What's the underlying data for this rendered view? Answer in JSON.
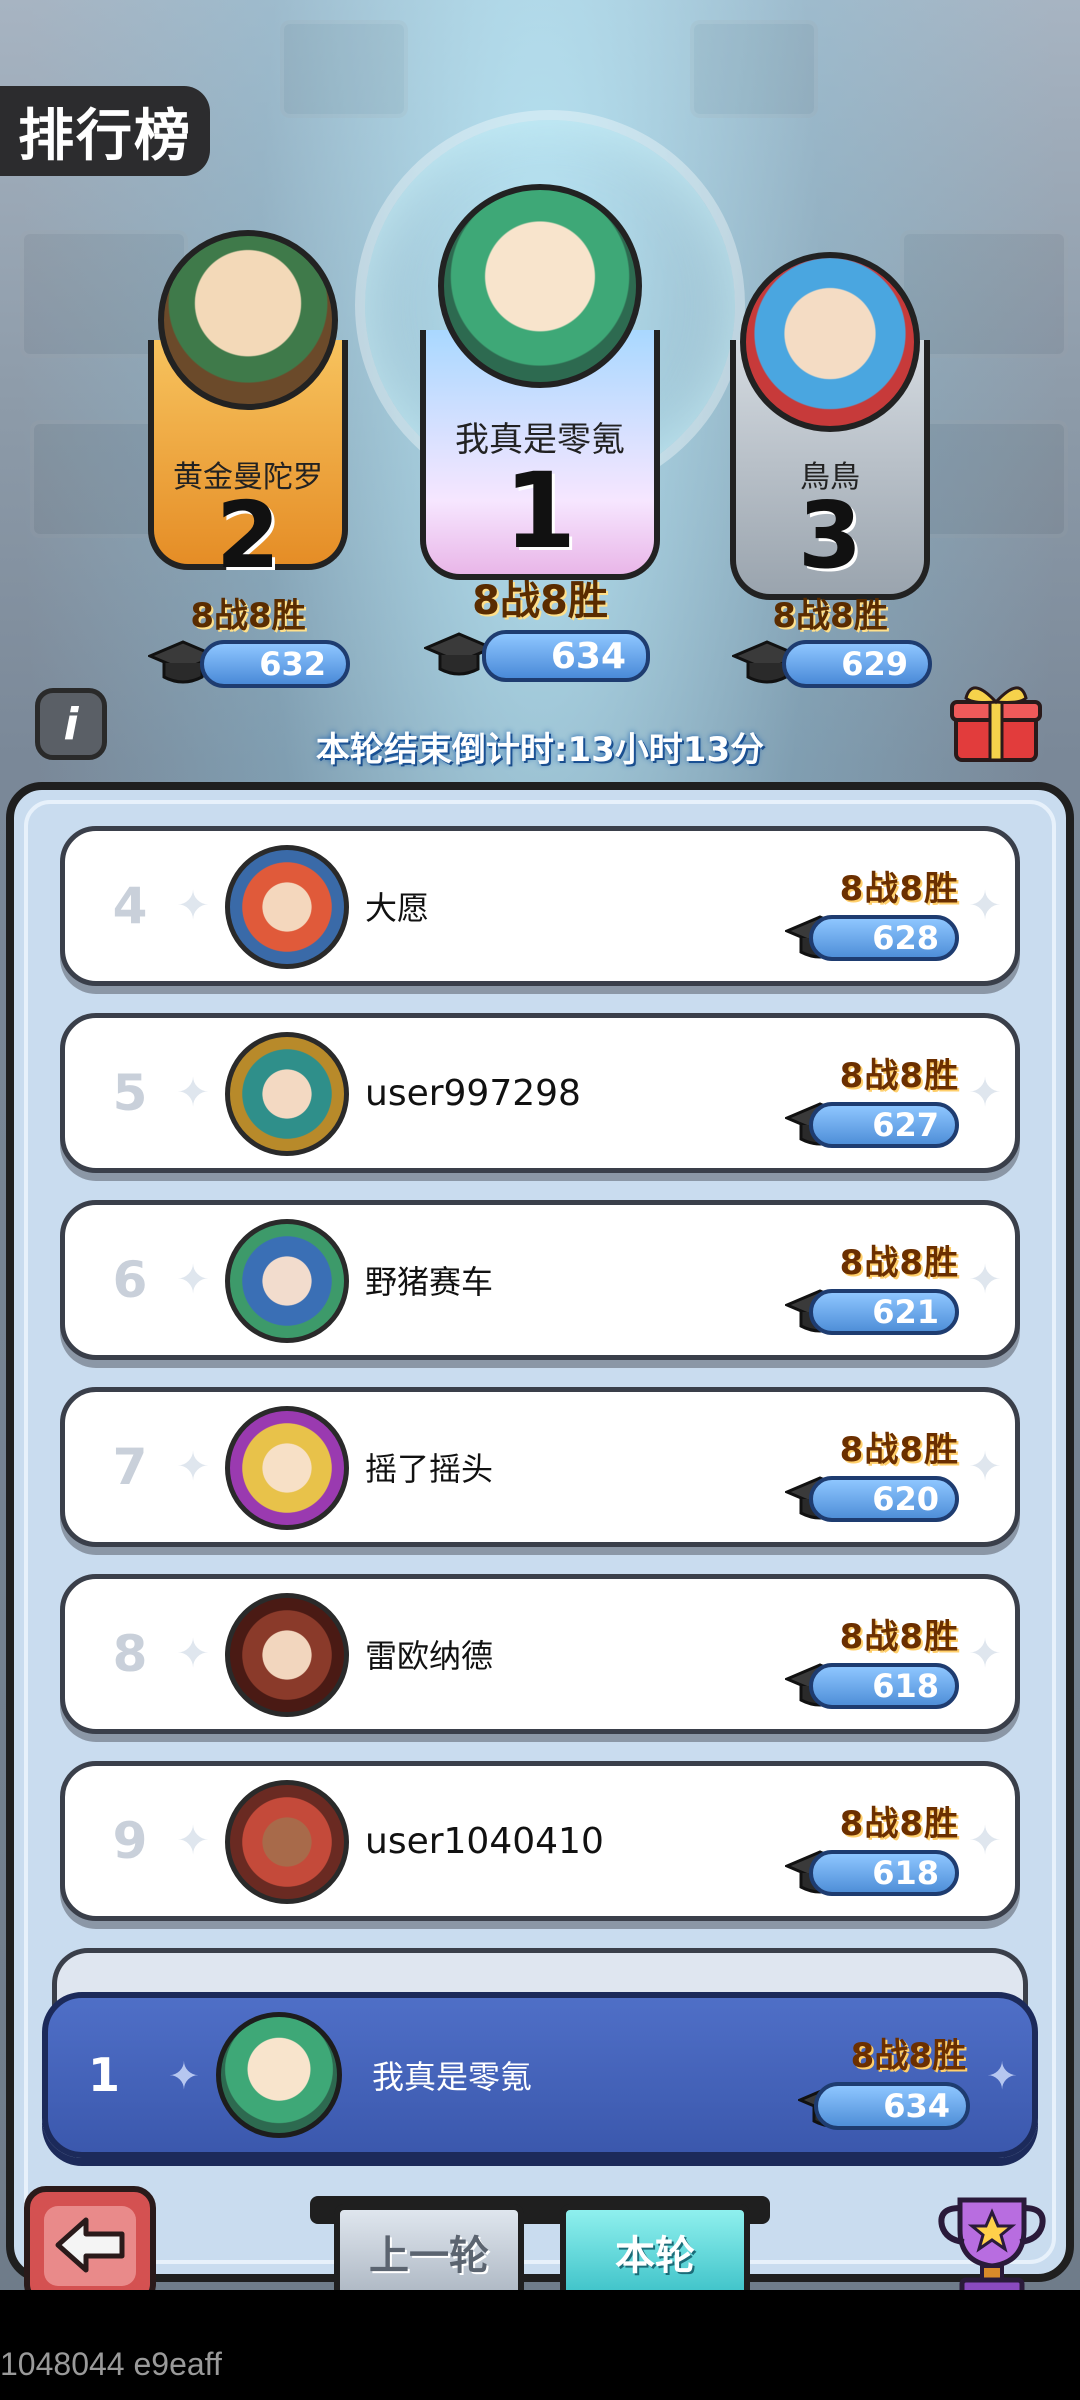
{
  "header": {
    "title": "排行榜"
  },
  "podium": [
    {
      "rank": "2",
      "name": "黄金曼陀罗",
      "record": "8战8胜",
      "score": "632",
      "banner_color": "#f0a23a"
    },
    {
      "rank": "1",
      "name": "我真是零氪",
      "record": "8战8胜",
      "score": "634",
      "banner_color": "#e8d8ff"
    },
    {
      "rank": "3",
      "name": "鳥鳥",
      "record": "8战8胜",
      "score": "629",
      "banner_color": "#b9c2ca"
    }
  ],
  "countdown": "本轮结束倒计时:13小时13分",
  "rows": [
    {
      "rank": "4",
      "name": "大愿",
      "record": "8战8胜",
      "score": "628"
    },
    {
      "rank": "5",
      "name": "user997298",
      "record": "8战8胜",
      "score": "627"
    },
    {
      "rank": "6",
      "name": "野猪赛车",
      "record": "8战8胜",
      "score": "621"
    },
    {
      "rank": "7",
      "name": "摇了摇头",
      "record": "8战8胜",
      "score": "620"
    },
    {
      "rank": "8",
      "name": "雷欧纳德",
      "record": "8战8胜",
      "score": "618"
    },
    {
      "rank": "9",
      "name": "user1040410",
      "record": "8战8胜",
      "score": "618"
    }
  ],
  "me": {
    "rank": "1",
    "name": "我真是零氪",
    "record": "8战8胜",
    "score": "634"
  },
  "tabs": {
    "prev": "上一轮",
    "current": "本轮"
  },
  "footer": "1048044 e9eaff",
  "icons": {
    "info": "info-icon",
    "gift": "gift-icon",
    "back": "back-arrow-icon",
    "trophy": "trophy-icon",
    "cap": "graduation-cap-icon"
  }
}
